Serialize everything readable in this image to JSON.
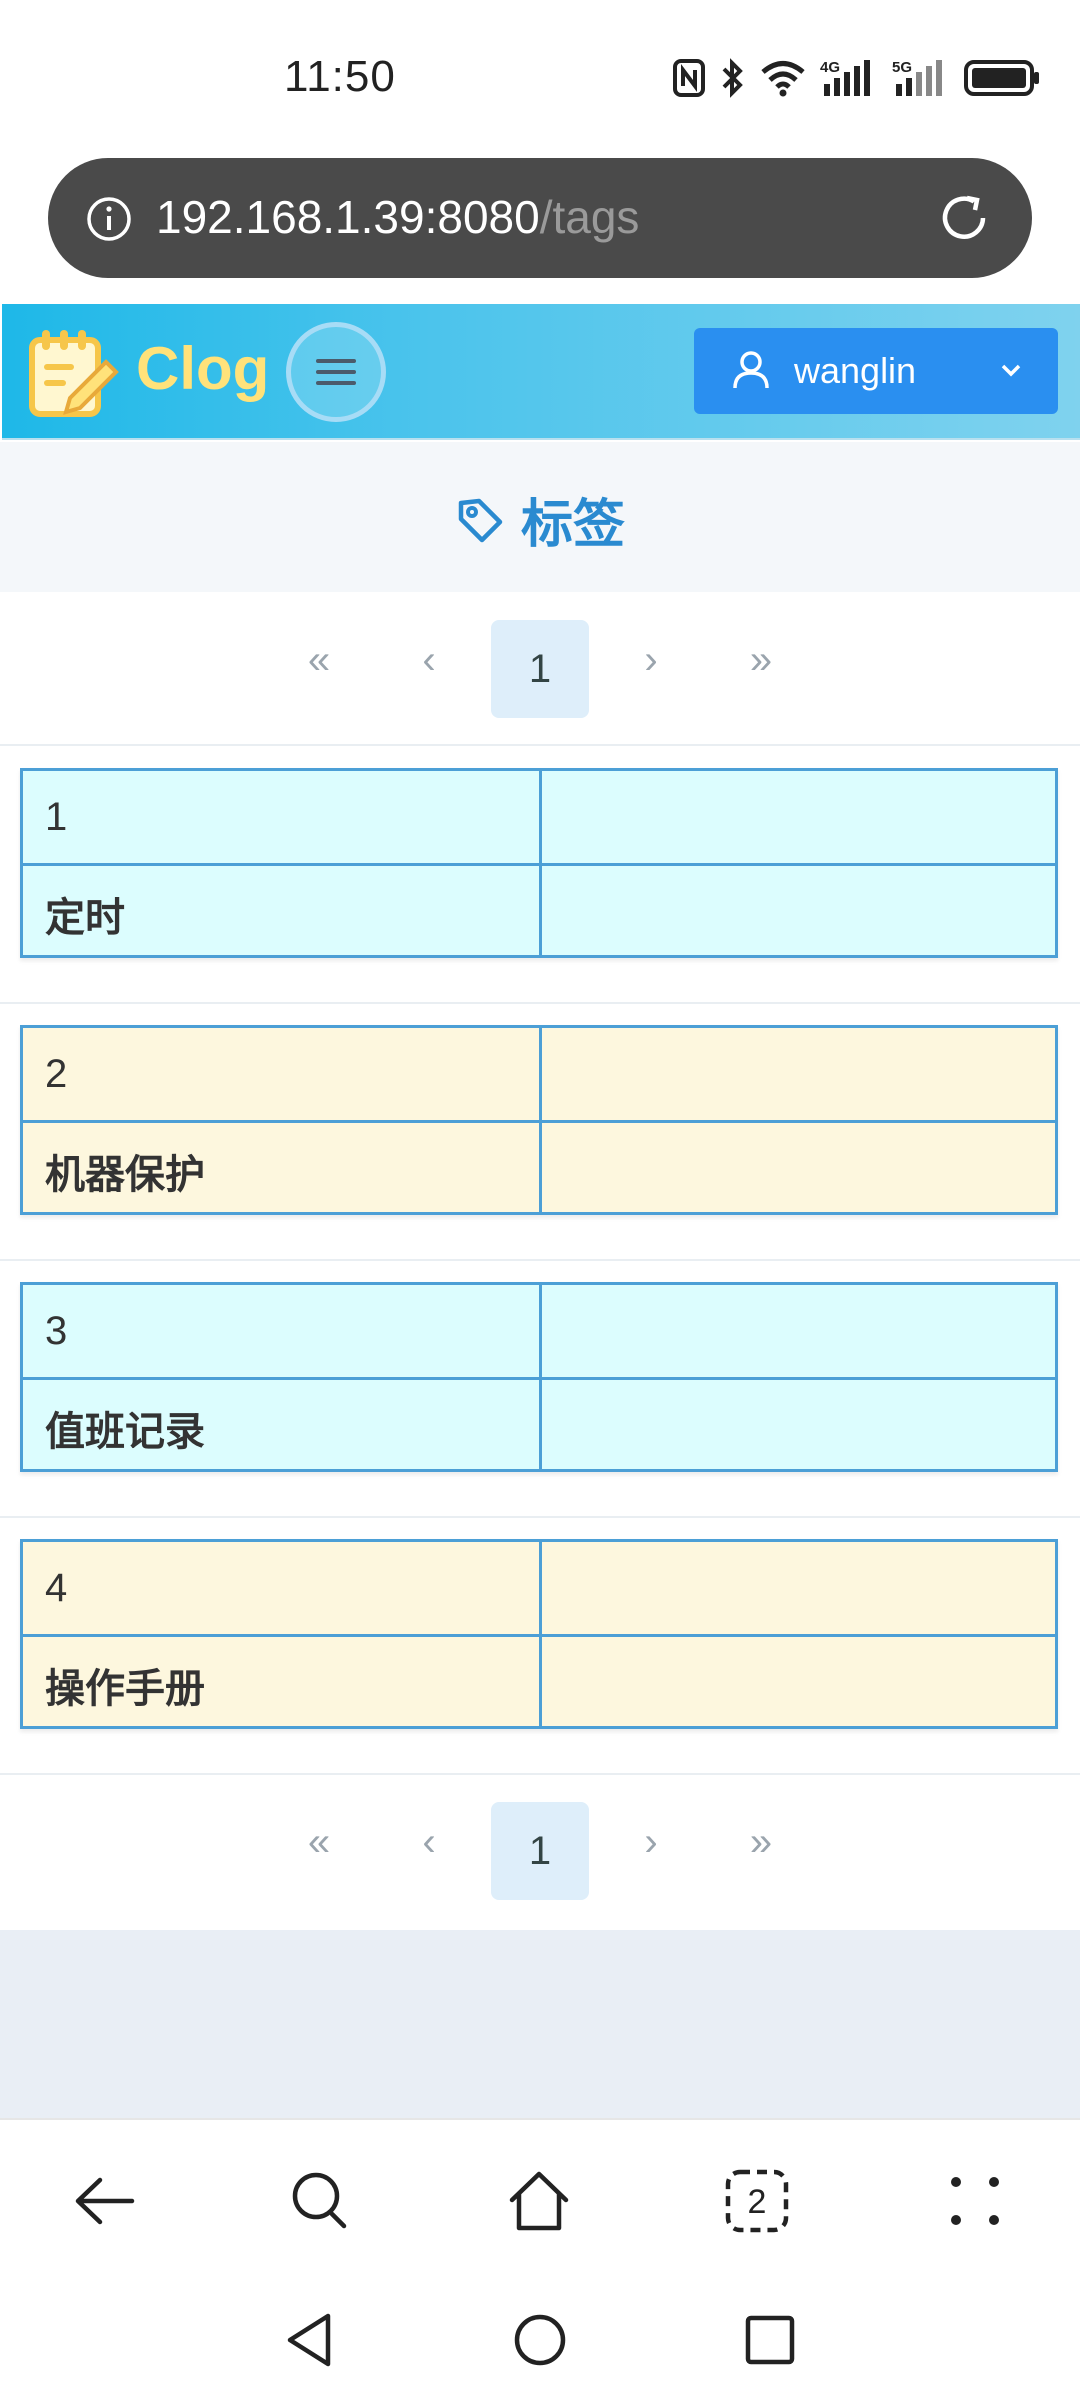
{
  "status_bar": {
    "time": "11:50",
    "icons": [
      "nfc-icon",
      "bluetooth-icon",
      "wifi-icon",
      "4g-signal-icon",
      "5g-signal-icon",
      "battery-icon"
    ],
    "network_labels": [
      "4G",
      "5G"
    ]
  },
  "url_bar": {
    "host": "192.168.1.39:8080",
    "path": "/tags"
  },
  "header": {
    "app_name": "Clog",
    "user": "wanglin",
    "accent": "#2a8ff0",
    "logo_color": "#ffe27a"
  },
  "page": {
    "title": "标签"
  },
  "pagination": {
    "first": "«",
    "prev": "‹",
    "current": "1",
    "next": "›",
    "last": "»"
  },
  "tags": [
    {
      "id": "1",
      "name": "定时",
      "color": "#dcfdfe"
    },
    {
      "id": "2",
      "name": "机器保护",
      "color": "#fdf7de"
    },
    {
      "id": "3",
      "name": "值班记录",
      "color": "#dcfdfe"
    },
    {
      "id": "4",
      "name": "操作手册",
      "color": "#fdf7de"
    }
  ],
  "browser_nav": [
    "back-icon",
    "search-icon",
    "home-icon",
    "tabs-icon",
    "more-icon"
  ],
  "browser_tabs_count": "2",
  "system_nav": [
    "back-triangle-icon",
    "home-circle-icon",
    "recents-square-icon"
  ]
}
